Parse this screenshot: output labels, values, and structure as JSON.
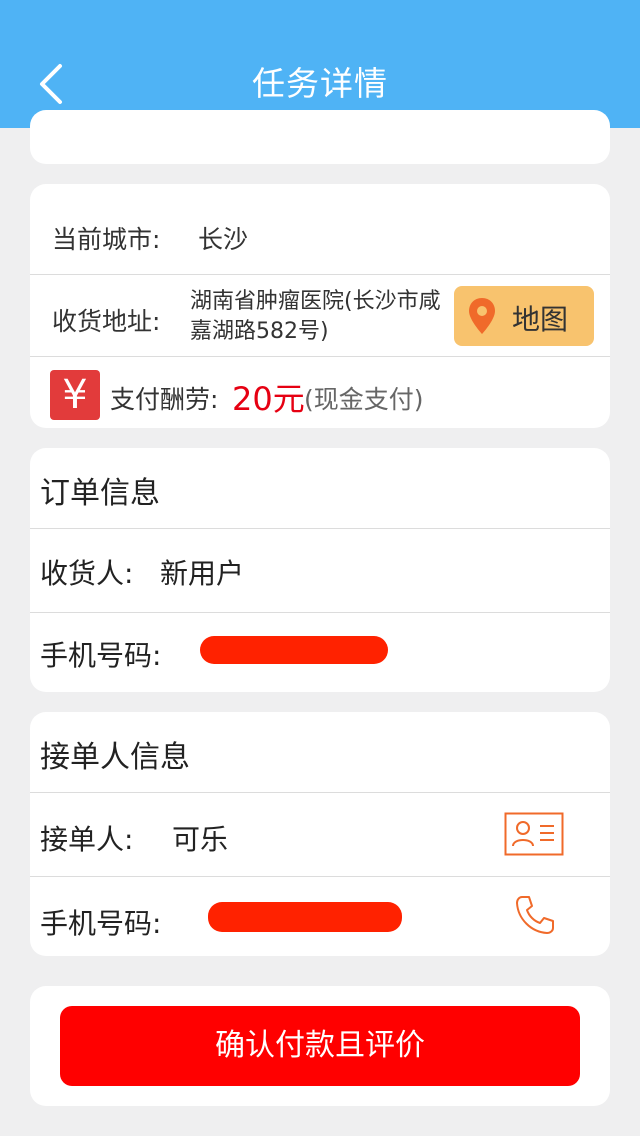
{
  "nav": {
    "title": "任务详情"
  },
  "task": {
    "city_label": "当前城市:",
    "city_value": "长沙",
    "address_label": "收货地址:",
    "address_value": "湖南省肿瘤医院(长沙市咸嘉湖路582号)",
    "map_label": "地图",
    "pay_label": "支付酬劳:",
    "pay_amount": "20元",
    "pay_note": "(现金支付)",
    "yen_symbol": "¥"
  },
  "order": {
    "title": "订单信息",
    "receiver_label": "收货人:",
    "receiver_value": "新用户",
    "phone_label": "手机号码:"
  },
  "taker": {
    "title": "接单人信息",
    "taker_label": "接单人:",
    "taker_value": "可乐",
    "phone_label": "手机号码:"
  },
  "actions": {
    "confirm_label": "确认付款且评价"
  },
  "colors": {
    "nav_bg": "#4fb3f5",
    "accent_red": "#e60012",
    "button_red": "#ff0000",
    "map_button": "#f8c36e",
    "icon_orange": "#f06a2a"
  },
  "icons": [
    "back-arrow-icon",
    "location-pin-icon",
    "yen-icon",
    "contact-card-icon",
    "phone-icon"
  ]
}
